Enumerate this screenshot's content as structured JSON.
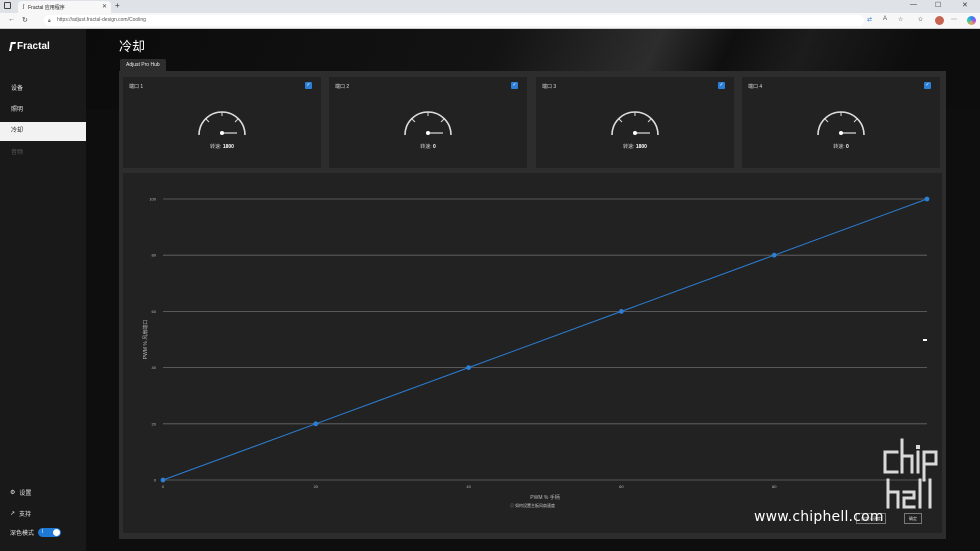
{
  "browser": {
    "tab_title": "Fractal 应用程序",
    "url": "https://adjust.fractal-design.com/Cooling"
  },
  "sidebar": {
    "brand": "Fractal",
    "items": [
      {
        "label": "设备",
        "state": "normal"
      },
      {
        "label": "照明",
        "state": "normal"
      },
      {
        "label": "冷却",
        "state": "active"
      },
      {
        "label": "音频",
        "state": "disabled"
      }
    ],
    "settings_label": "设置",
    "support_label": "支持",
    "dark_mode_label": "深色模式",
    "dark_mode_on": true
  },
  "page": {
    "title": "冷却",
    "hub_tab": "Adjust Pro Hub"
  },
  "ports": [
    {
      "label": "端口 1",
      "speed_label": "转速:",
      "speed": "1800",
      "checked": true
    },
    {
      "label": "端口 2",
      "speed_label": "转速:",
      "speed": "0",
      "checked": true
    },
    {
      "label": "端口 3",
      "speed_label": "转速:",
      "speed": "1800",
      "checked": true
    },
    {
      "label": "端口 4",
      "speed_label": "转速:",
      "speed": "0",
      "checked": true
    }
  ],
  "chart_data": {
    "type": "line",
    "xlabel": "PWM % 手柄",
    "ylabel": "PWM % 风扇端口",
    "xlim": [
      0,
      100
    ],
    "ylim": [
      0,
      100
    ],
    "x_ticks": [
      0,
      20,
      40,
      60,
      80
    ],
    "y_ticks": [
      0,
      20,
      40,
      60,
      80,
      100
    ],
    "grid": true,
    "series": [
      {
        "x": [
          0,
          20,
          40,
          60,
          80,
          100
        ],
        "values": [
          0,
          20,
          40,
          60,
          80,
          100
        ],
        "color": "#2b7fd6"
      }
    ],
    "footnote": "如何设置主板风扇速度"
  },
  "buttons": {
    "left": "自定义速度",
    "right": "确定"
  },
  "watermark": {
    "url": "www.chiphell.com"
  }
}
